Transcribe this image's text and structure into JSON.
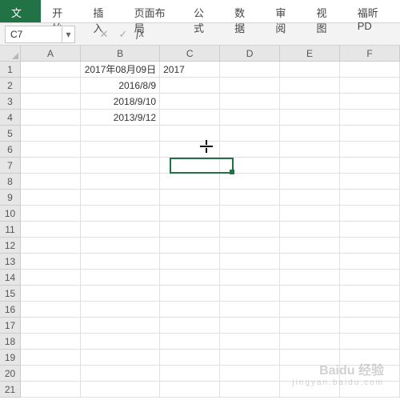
{
  "tabs": {
    "file": "文件",
    "home": "开始",
    "insert": "插入",
    "pagelayout": "页面布局",
    "formulas": "公式",
    "data": "数据",
    "review": "审阅",
    "view": "视图",
    "foxit": "福昕PD"
  },
  "namebox": {
    "value": "C7"
  },
  "fx": {
    "label": "fx",
    "x": "✕",
    "check": "✓"
  },
  "columns": [
    "A",
    "B",
    "C",
    "D",
    "E",
    "F"
  ],
  "rows": [
    "1",
    "2",
    "3",
    "4",
    "5",
    "6",
    "7",
    "8",
    "9",
    "10",
    "11",
    "12",
    "13",
    "14",
    "15",
    "16",
    "17",
    "18",
    "19",
    "20",
    "21"
  ],
  "cells": {
    "B1": "2017年08月09日",
    "B2": "2016/8/9",
    "B3": "2018/9/10",
    "B4": "2013/9/12",
    "C1": "2017"
  },
  "watermark": {
    "brand": "Baidu 经验",
    "sub": "jingyan.baidu.com"
  }
}
